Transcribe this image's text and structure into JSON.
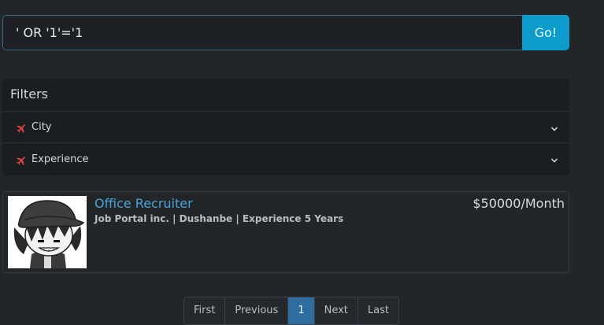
{
  "search": {
    "value": "' OR '1'='1",
    "button_label": "Go!"
  },
  "filters": {
    "title": "Filters",
    "items": [
      {
        "label": "City",
        "icon": "plane-icon"
      },
      {
        "label": "Experience",
        "icon": "plane-icon"
      }
    ]
  },
  "job": {
    "title": "Office Recruiter",
    "meta": "Job Portal inc. | Dushanbe | Experience 5 Years",
    "salary": "$50000/Month"
  },
  "pagination": {
    "first": "First",
    "previous": "Previous",
    "current": "1",
    "next": "Next",
    "last": "Last"
  },
  "colors": {
    "accent": "#0b9ccc",
    "link": "#4aa3d8",
    "active_page": "#2f6c9f",
    "icon_red": "#e0413b"
  }
}
